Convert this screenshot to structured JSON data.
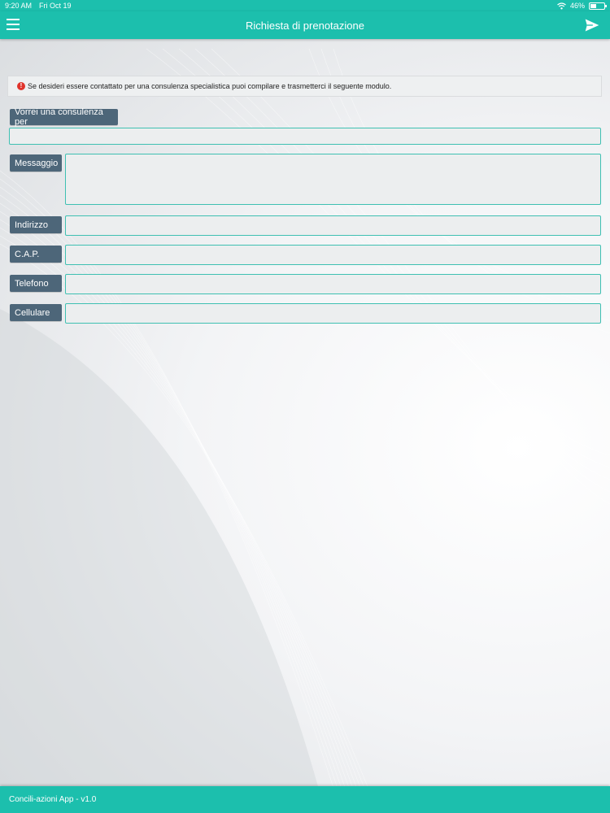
{
  "status_bar": {
    "time": "9:20 AM",
    "date": "Fri Oct 19",
    "battery_percent": "46%",
    "battery_level": 0.46,
    "icons": [
      "wifi-icon",
      "battery-icon"
    ]
  },
  "nav": {
    "title": "Richiesta di prenotazione",
    "menu_icon": "hamburger-menu-icon",
    "send_icon": "paper-plane-send-icon"
  },
  "info": {
    "icon": "exclamation-alert-icon",
    "text": "Se desideri essere contattato per una consulenza specialistica puoi compilare e trasmetterci il seguente modulo."
  },
  "form": {
    "consulenza_label": "Vorrei una consulenza per",
    "consulenza_value": "",
    "messaggio_label": "Messaggio",
    "messaggio_value": "",
    "indirizzo_label": "Indirizzo",
    "indirizzo_value": "",
    "cap_label": "C.A.P.",
    "cap_value": "",
    "telefono_label": "Telefono",
    "telefono_value": "",
    "cellulare_label": "Cellulare",
    "cellulare_value": ""
  },
  "footer": {
    "text": "Concili-azioni App - v1.0"
  },
  "colors": {
    "primary": "#1cbfad",
    "label_bg": "#4d6679",
    "field_border": "#3fc0b2",
    "alert": "#e0332b"
  }
}
